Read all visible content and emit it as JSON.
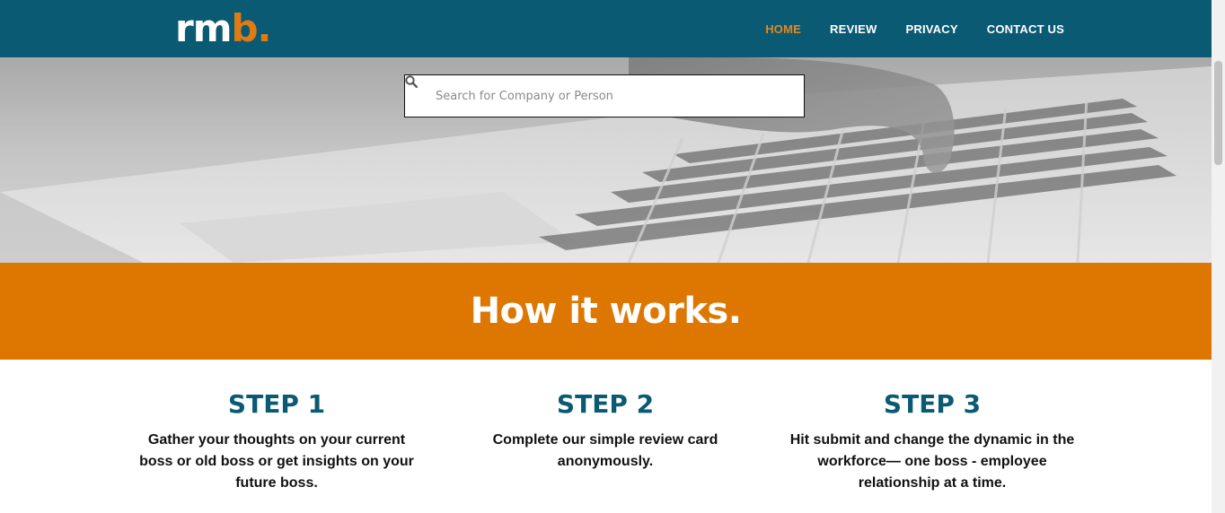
{
  "header": {
    "logo_main": "rm",
    "logo_accent": "b.",
    "nav": [
      {
        "label": "HOME",
        "active": true
      },
      {
        "label": "REVIEW",
        "active": false
      },
      {
        "label": "PRIVACY",
        "active": false
      },
      {
        "label": "CONTACT US",
        "active": false
      }
    ]
  },
  "hero": {
    "search": {
      "placeholder": "Search for Company or Person",
      "icon": "search-icon"
    }
  },
  "band": {
    "title": "How it works."
  },
  "steps": [
    {
      "title": "STEP 1",
      "text": "Gather your thoughts on your current boss or old boss or get insights on your future boss."
    },
    {
      "title": "STEP 2",
      "text": "Complete our simple review card anonymously."
    },
    {
      "title": "STEP 3",
      "text": "Hit submit and change the dynamic in the workforce— one boss - employee relationship at a time."
    }
  ],
  "colors": {
    "header": "#0b5a74",
    "accent": "#e07b14",
    "band": "#dd7702",
    "step_title": "#0b5a74"
  }
}
